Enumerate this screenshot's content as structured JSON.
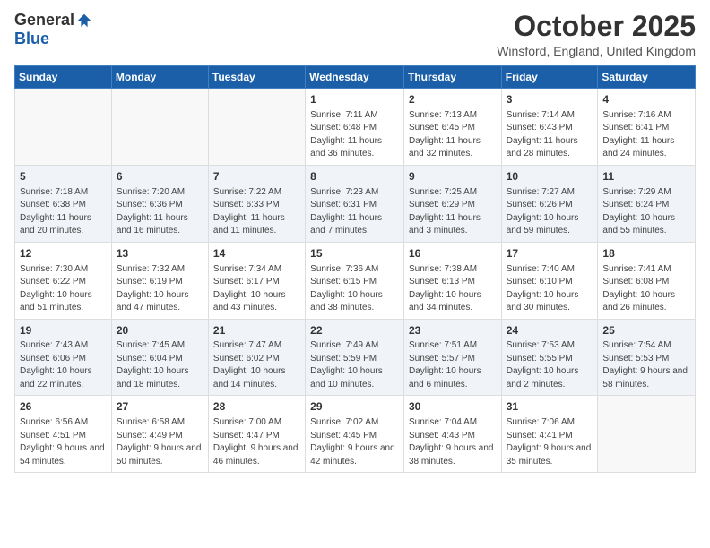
{
  "logo": {
    "general": "General",
    "blue": "Blue"
  },
  "title": "October 2025",
  "location": "Winsford, England, United Kingdom",
  "headers": [
    "Sunday",
    "Monday",
    "Tuesday",
    "Wednesday",
    "Thursday",
    "Friday",
    "Saturday"
  ],
  "weeks": [
    [
      {
        "day": "",
        "info": ""
      },
      {
        "day": "",
        "info": ""
      },
      {
        "day": "",
        "info": ""
      },
      {
        "day": "1",
        "info": "Sunrise: 7:11 AM\nSunset: 6:48 PM\nDaylight: 11 hours and 36 minutes."
      },
      {
        "day": "2",
        "info": "Sunrise: 7:13 AM\nSunset: 6:45 PM\nDaylight: 11 hours and 32 minutes."
      },
      {
        "day": "3",
        "info": "Sunrise: 7:14 AM\nSunset: 6:43 PM\nDaylight: 11 hours and 28 minutes."
      },
      {
        "day": "4",
        "info": "Sunrise: 7:16 AM\nSunset: 6:41 PM\nDaylight: 11 hours and 24 minutes."
      }
    ],
    [
      {
        "day": "5",
        "info": "Sunrise: 7:18 AM\nSunset: 6:38 PM\nDaylight: 11 hours and 20 minutes."
      },
      {
        "day": "6",
        "info": "Sunrise: 7:20 AM\nSunset: 6:36 PM\nDaylight: 11 hours and 16 minutes."
      },
      {
        "day": "7",
        "info": "Sunrise: 7:22 AM\nSunset: 6:33 PM\nDaylight: 11 hours and 11 minutes."
      },
      {
        "day": "8",
        "info": "Sunrise: 7:23 AM\nSunset: 6:31 PM\nDaylight: 11 hours and 7 minutes."
      },
      {
        "day": "9",
        "info": "Sunrise: 7:25 AM\nSunset: 6:29 PM\nDaylight: 11 hours and 3 minutes."
      },
      {
        "day": "10",
        "info": "Sunrise: 7:27 AM\nSunset: 6:26 PM\nDaylight: 10 hours and 59 minutes."
      },
      {
        "day": "11",
        "info": "Sunrise: 7:29 AM\nSunset: 6:24 PM\nDaylight: 10 hours and 55 minutes."
      }
    ],
    [
      {
        "day": "12",
        "info": "Sunrise: 7:30 AM\nSunset: 6:22 PM\nDaylight: 10 hours and 51 minutes."
      },
      {
        "day": "13",
        "info": "Sunrise: 7:32 AM\nSunset: 6:19 PM\nDaylight: 10 hours and 47 minutes."
      },
      {
        "day": "14",
        "info": "Sunrise: 7:34 AM\nSunset: 6:17 PM\nDaylight: 10 hours and 43 minutes."
      },
      {
        "day": "15",
        "info": "Sunrise: 7:36 AM\nSunset: 6:15 PM\nDaylight: 10 hours and 38 minutes."
      },
      {
        "day": "16",
        "info": "Sunrise: 7:38 AM\nSunset: 6:13 PM\nDaylight: 10 hours and 34 minutes."
      },
      {
        "day": "17",
        "info": "Sunrise: 7:40 AM\nSunset: 6:10 PM\nDaylight: 10 hours and 30 minutes."
      },
      {
        "day": "18",
        "info": "Sunrise: 7:41 AM\nSunset: 6:08 PM\nDaylight: 10 hours and 26 minutes."
      }
    ],
    [
      {
        "day": "19",
        "info": "Sunrise: 7:43 AM\nSunset: 6:06 PM\nDaylight: 10 hours and 22 minutes."
      },
      {
        "day": "20",
        "info": "Sunrise: 7:45 AM\nSunset: 6:04 PM\nDaylight: 10 hours and 18 minutes."
      },
      {
        "day": "21",
        "info": "Sunrise: 7:47 AM\nSunset: 6:02 PM\nDaylight: 10 hours and 14 minutes."
      },
      {
        "day": "22",
        "info": "Sunrise: 7:49 AM\nSunset: 5:59 PM\nDaylight: 10 hours and 10 minutes."
      },
      {
        "day": "23",
        "info": "Sunrise: 7:51 AM\nSunset: 5:57 PM\nDaylight: 10 hours and 6 minutes."
      },
      {
        "day": "24",
        "info": "Sunrise: 7:53 AM\nSunset: 5:55 PM\nDaylight: 10 hours and 2 minutes."
      },
      {
        "day": "25",
        "info": "Sunrise: 7:54 AM\nSunset: 5:53 PM\nDaylight: 9 hours and 58 minutes."
      }
    ],
    [
      {
        "day": "26",
        "info": "Sunrise: 6:56 AM\nSunset: 4:51 PM\nDaylight: 9 hours and 54 minutes."
      },
      {
        "day": "27",
        "info": "Sunrise: 6:58 AM\nSunset: 4:49 PM\nDaylight: 9 hours and 50 minutes."
      },
      {
        "day": "28",
        "info": "Sunrise: 7:00 AM\nSunset: 4:47 PM\nDaylight: 9 hours and 46 minutes."
      },
      {
        "day": "29",
        "info": "Sunrise: 7:02 AM\nSunset: 4:45 PM\nDaylight: 9 hours and 42 minutes."
      },
      {
        "day": "30",
        "info": "Sunrise: 7:04 AM\nSunset: 4:43 PM\nDaylight: 9 hours and 38 minutes."
      },
      {
        "day": "31",
        "info": "Sunrise: 7:06 AM\nSunset: 4:41 PM\nDaylight: 9 hours and 35 minutes."
      },
      {
        "day": "",
        "info": ""
      }
    ]
  ]
}
